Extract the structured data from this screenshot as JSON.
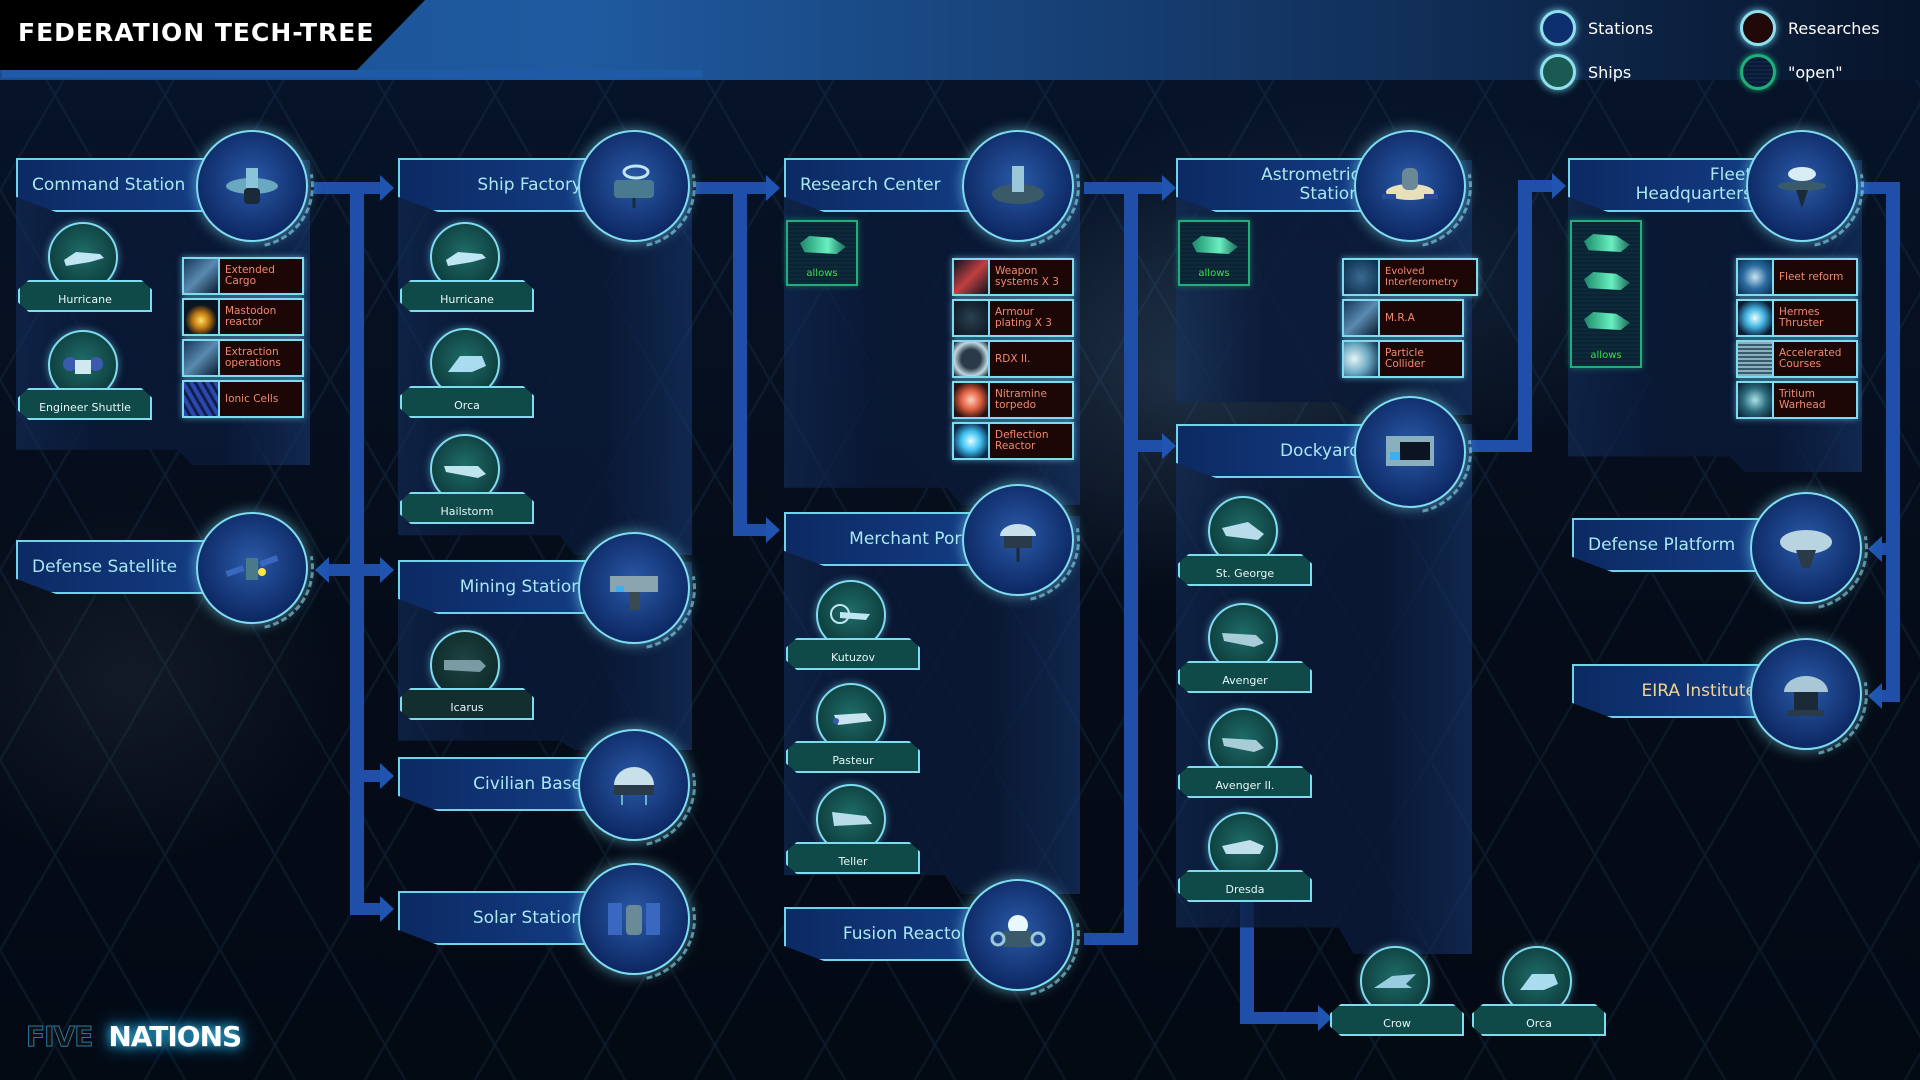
{
  "title": "FEDERATION TECH-TREE",
  "legend": [
    {
      "label": "Stations",
      "color": "#0e2f6e"
    },
    {
      "label": "Ships",
      "color": "#1a5a52"
    },
    {
      "label": "Researches",
      "color": "#200808"
    },
    {
      "label": "\"open\"",
      "color": "#0a1f36"
    }
  ],
  "allows_label": "allows",
  "stations": {
    "command_station": {
      "name": "Command Station",
      "ships": [
        "Hurricane",
        "Engineer Shuttle"
      ],
      "researches": [
        "Extended Cargo",
        "Mastodon reactor",
        "Extraction operations",
        "Ionic Cells"
      ]
    },
    "defense_satellite": {
      "name": "Defense Satellite"
    },
    "ship_factory": {
      "name": "Ship Factory",
      "ships": [
        "Hurricane",
        "Orca",
        "Hailstorm"
      ]
    },
    "mining_station": {
      "name": "Mining Station",
      "ships": [
        "Icarus"
      ]
    },
    "civilian_base": {
      "name": "Civilian Base"
    },
    "solar_station": {
      "name": "Solar Station"
    },
    "research_center": {
      "name": "Research Center",
      "researches": [
        "Weapon systems X 3",
        "Armour plating X 3",
        "RDX II.",
        "Nitramine torpedo",
        "Deflection Reactor"
      ]
    },
    "merchant_port": {
      "name": "Merchant Port",
      "ships": [
        "Kutuzov",
        "Pasteur",
        "Teller"
      ]
    },
    "fusion_reactor": {
      "name": "Fusion Reactor"
    },
    "astrometric_station": {
      "name_line1": "Astrometric",
      "name_line2": "Station",
      "researches": [
        "Evolved Interferometry",
        "M.R.A",
        "Particle Collider"
      ]
    },
    "dockyard": {
      "name": "Dockyard",
      "ships": [
        "St. George",
        "Avenger",
        "Avenger II.",
        "Dresda",
        "Crow",
        "Orca"
      ]
    },
    "fleet_headquarters": {
      "name_line1": "Fleet",
      "name_line2": "Headquarters",
      "researches": [
        "Fleet reform",
        "Hermes Thruster",
        "Accelerated Courses",
        "Tritium Warhead"
      ]
    },
    "defense_platform": {
      "name": "Defense Platform"
    },
    "eira_institute": {
      "name": "EIRA Institute"
    }
  },
  "logo": {
    "part1": "FIVE",
    "part2": "NATIONS"
  }
}
